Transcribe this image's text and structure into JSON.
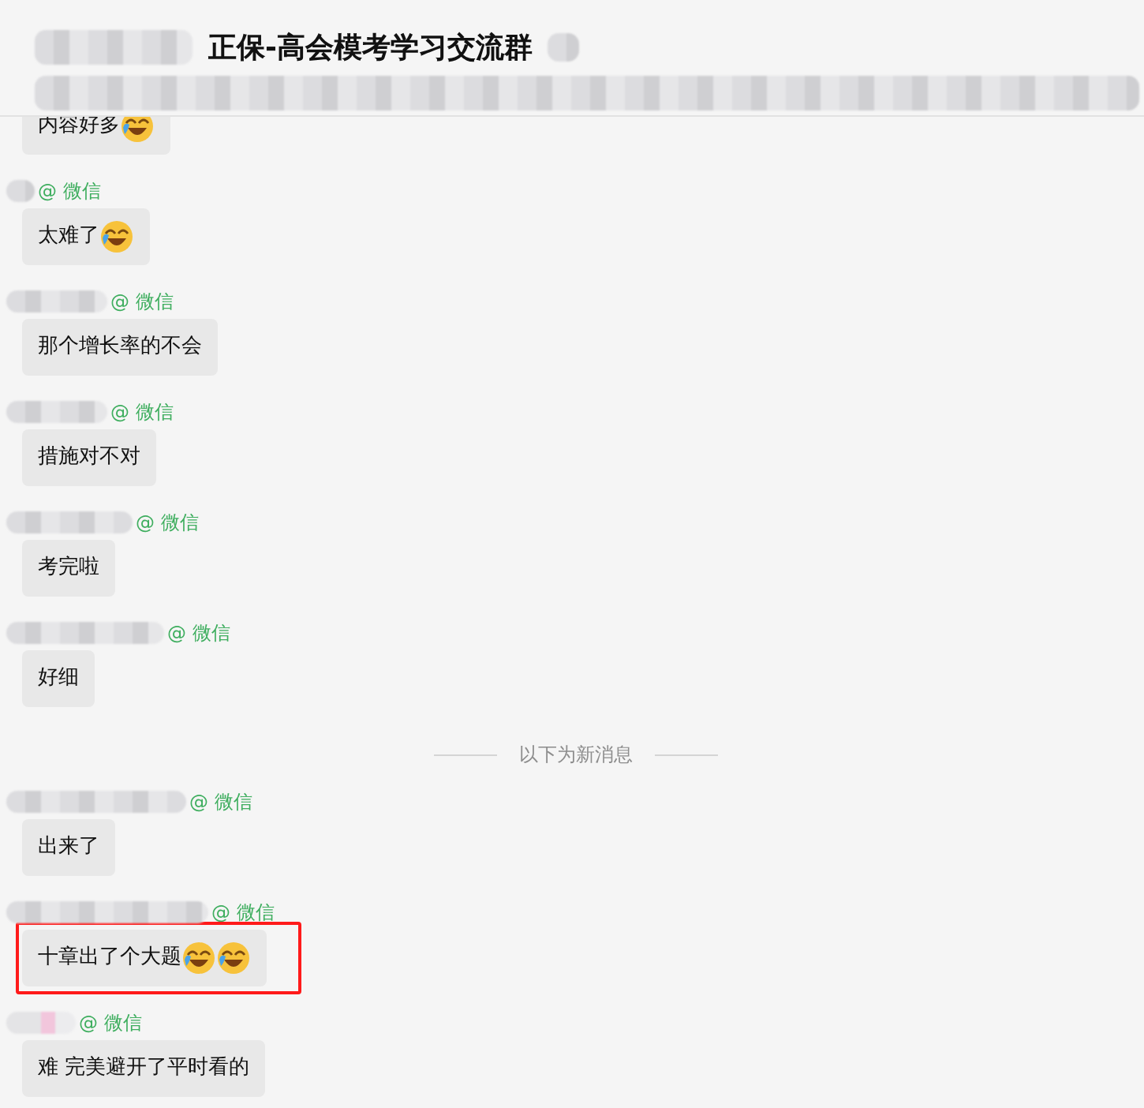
{
  "header": {
    "title": "正保-高会模考学习交流群"
  },
  "messages": [
    {
      "text": "内容好多",
      "icons": [
        {
          "kind": "laughing-crying"
        }
      ],
      "highlighted": false
    },
    {
      "sender": "@ 微信",
      "text": "太难了",
      "icons": [
        {
          "kind": "laughing-crying"
        }
      ],
      "highlighted": false
    },
    {
      "sender": "@ 微信",
      "text": "那个增长率的不会",
      "highlighted": false
    },
    {
      "sender": "@ 微信",
      "text": "措施对不对",
      "highlighted": false
    },
    {
      "sender": "@ 微信",
      "text": "考完啦",
      "highlighted": false
    },
    {
      "sender": "@ 微信",
      "text": "好细",
      "highlighted": false
    },
    {
      "kind": "divider",
      "text": "以下为新消息"
    },
    {
      "sender": "@ 微信",
      "text": "出来了",
      "highlighted": false
    },
    {
      "sender": "@ 微信",
      "text": "十章出了个大题",
      "icons": [
        {
          "kind": "laughing-crying"
        },
        {
          "kind": "laughing-crying"
        }
      ],
      "highlighted": true
    },
    {
      "sender": "@ 微信",
      "text": "难 完美避开了平时看的",
      "highlighted": false
    }
  ]
}
